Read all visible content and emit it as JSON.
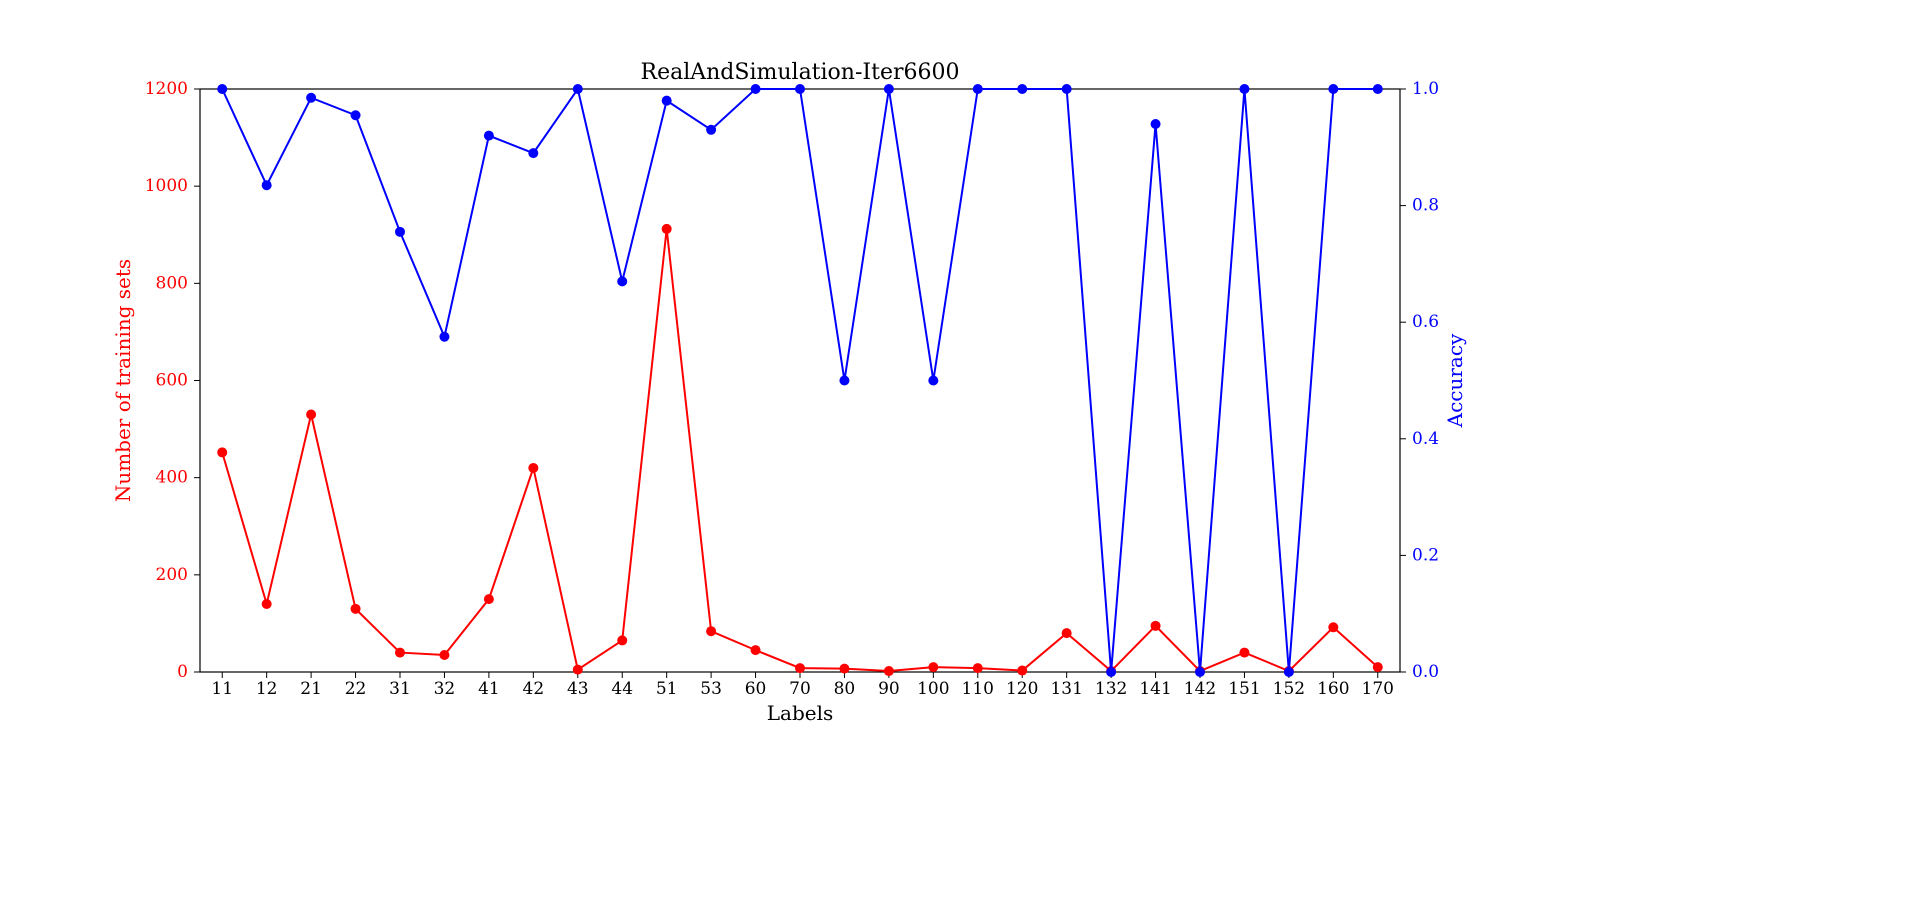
{
  "chart_data": {
    "type": "line",
    "title": "RealAndSimulation-Iter6600",
    "xlabel": "Labels",
    "ylabel_left": "Number of training sets",
    "ylabel_right": "Accuracy",
    "categories": [
      "11",
      "12",
      "21",
      "22",
      "31",
      "32",
      "41",
      "42",
      "43",
      "44",
      "51",
      "53",
      "60",
      "70",
      "80",
      "90",
      "100",
      "110",
      "120",
      "131",
      "132",
      "141",
      "142",
      "151",
      "152",
      "160",
      "170"
    ],
    "series": [
      {
        "name": "Number of training sets",
        "axis": "left",
        "color": "#ff0000",
        "values": [
          452,
          140,
          530,
          130,
          40,
          35,
          150,
          420,
          5,
          65,
          912,
          84,
          45,
          8,
          7,
          2,
          10,
          8,
          3,
          80,
          2,
          95,
          2,
          40,
          2,
          92,
          10
        ]
      },
      {
        "name": "Accuracy",
        "axis": "right",
        "color": "#0000ff",
        "values": [
          1.0,
          0.835,
          0.985,
          0.955,
          0.755,
          0.575,
          0.92,
          0.89,
          1.0,
          0.67,
          0.98,
          0.93,
          1.0,
          1.0,
          0.5,
          1.0,
          0.5,
          1.0,
          1.0,
          1.0,
          0.0,
          0.94,
          0.0,
          1.0,
          0.0,
          1.0,
          1.0
        ]
      }
    ],
    "ylim_left": [
      0,
      1200
    ],
    "yticks_left": [
      0,
      200,
      400,
      600,
      800,
      1000,
      1200
    ],
    "ylim_right": [
      0.0,
      1.0
    ],
    "yticks_right": [
      0.0,
      0.2,
      0.4,
      0.6,
      0.8,
      1.0
    ]
  }
}
